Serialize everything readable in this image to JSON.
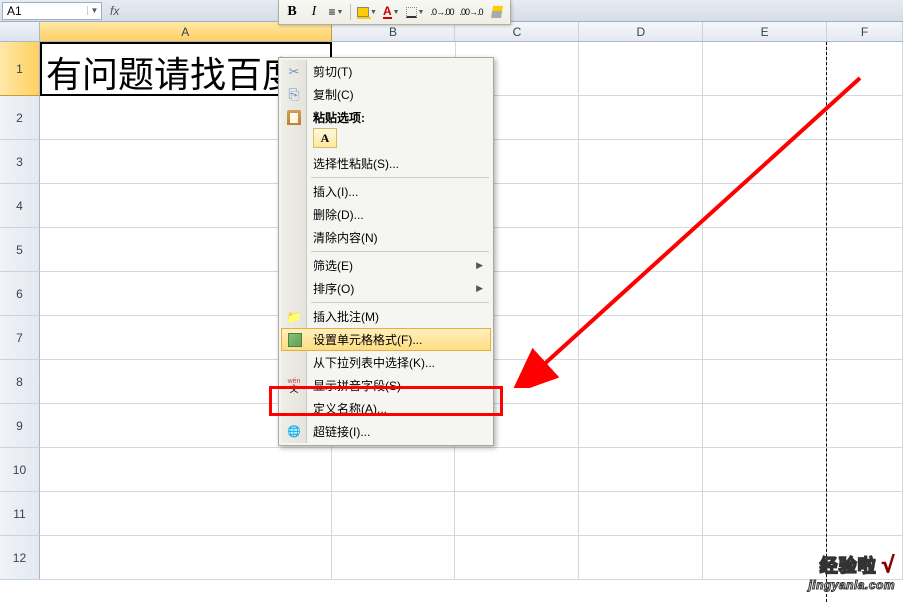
{
  "name_box": {
    "value": "A1"
  },
  "formula_prefix": "fx",
  "mini_toolbar": {
    "bold": "B",
    "italic": "I",
    "font_color_letter": "A",
    "decimal_inc": ".0 .00",
    "decimal_dec": ".00 .0"
  },
  "columns": [
    "A",
    "B",
    "C",
    "D",
    "E",
    "F"
  ],
  "rows": [
    "1",
    "2",
    "3",
    "4",
    "5",
    "6",
    "7",
    "8",
    "9",
    "10",
    "11",
    "12"
  ],
  "cells": {
    "A1": "有问题请找百度"
  },
  "context_menu": {
    "cut": "剪切(T)",
    "copy": "复制(C)",
    "paste_options": "粘贴选项:",
    "paste_opt_a": "A",
    "paste_special": "选择性粘贴(S)...",
    "insert": "插入(I)...",
    "delete": "删除(D)...",
    "clear": "清除内容(N)",
    "filter": "筛选(E)",
    "sort": "排序(O)",
    "insert_comment": "插入批注(M)",
    "format_cells": "设置单元格格式(F)...",
    "pick_from_list": "从下拉列表中选择(K)...",
    "show_pinyin": "显示拼音字段(S)",
    "define_name": "定义名称(A)...",
    "hyperlink": "超链接(I)..."
  },
  "watermark": {
    "line1": "经验啦",
    "check": "√",
    "line2": "jingyanla.com"
  }
}
